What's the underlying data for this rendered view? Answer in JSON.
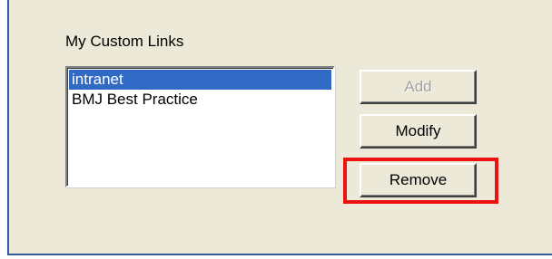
{
  "group": {
    "label": "My Custom Links"
  },
  "links_list": {
    "items": [
      {
        "label": "intranet",
        "selected": true
      },
      {
        "label": "BMJ Best Practice",
        "selected": false
      }
    ]
  },
  "buttons": {
    "add": {
      "label": "Add",
      "enabled": false
    },
    "modify": {
      "label": "Modify",
      "enabled": true
    },
    "remove": {
      "label": "Remove",
      "enabled": true
    }
  },
  "highlight": {
    "target": "remove-button",
    "color": "#ee1111"
  },
  "colors": {
    "selection": "#316ac5",
    "window_bg": "#ece9d8",
    "frame_border": "#2f5aa0"
  }
}
